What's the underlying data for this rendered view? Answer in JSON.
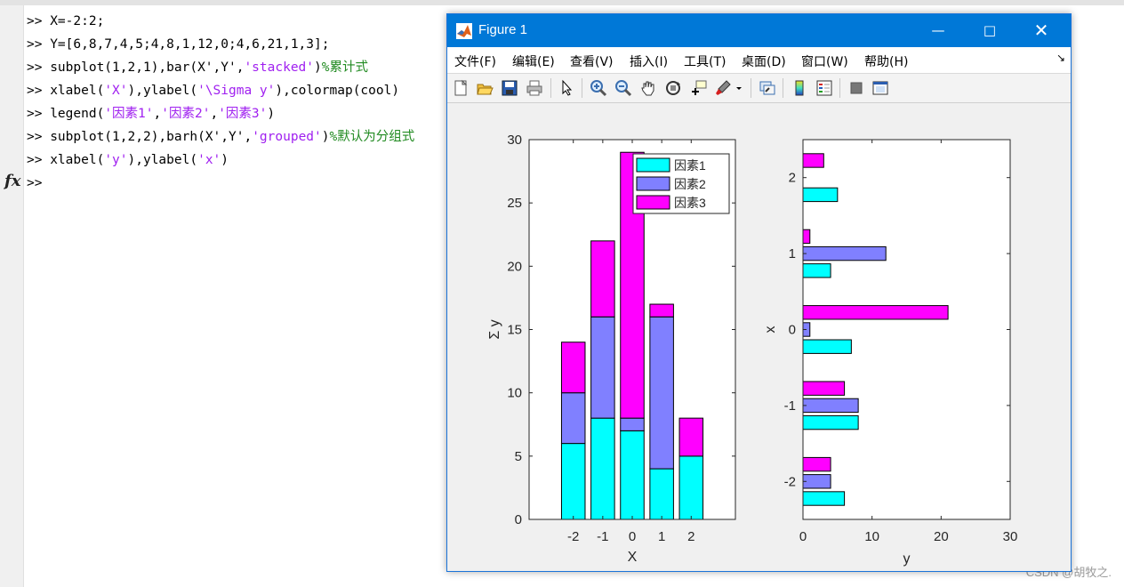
{
  "command_window": {
    "lines": [
      [
        {
          "t": ">> ",
          "c": "prompt"
        },
        {
          "t": "X=-2:2;",
          "c": "code"
        }
      ],
      [
        {
          "t": ">> ",
          "c": "prompt"
        },
        {
          "t": "Y=[6,8,7,4,5;4,8,1,12,0;4,6,21,1,3];",
          "c": "code"
        }
      ],
      [
        {
          "t": ">> ",
          "c": "prompt"
        },
        {
          "t": "subplot(1,2,1),bar(X',Y',",
          "c": "code"
        },
        {
          "t": "'stacked'",
          "c": "str"
        },
        {
          "t": ")",
          "c": "code"
        },
        {
          "t": "%累计式",
          "c": "cmt"
        }
      ],
      [
        {
          "t": ">> ",
          "c": "prompt"
        },
        {
          "t": "xlabel(",
          "c": "code"
        },
        {
          "t": "'X'",
          "c": "str"
        },
        {
          "t": "),ylabel(",
          "c": "code"
        },
        {
          "t": "'\\Sigma y'",
          "c": "str"
        },
        {
          "t": "),colormap(cool)",
          "c": "code"
        }
      ],
      [
        {
          "t": ">> ",
          "c": "prompt"
        },
        {
          "t": "legend(",
          "c": "code"
        },
        {
          "t": "'因素1'",
          "c": "str"
        },
        {
          "t": ",",
          "c": "code"
        },
        {
          "t": "'因素2'",
          "c": "str"
        },
        {
          "t": ",",
          "c": "code"
        },
        {
          "t": "'因素3'",
          "c": "str"
        },
        {
          "t": ")",
          "c": "code"
        }
      ],
      [
        {
          "t": ">> ",
          "c": "prompt"
        },
        {
          "t": "subplot(1,2,2),barh(X',Y',",
          "c": "code"
        },
        {
          "t": "'grouped'",
          "c": "str"
        },
        {
          "t": ")",
          "c": "code"
        },
        {
          "t": "%默认为分组式",
          "c": "cmt"
        }
      ],
      [
        {
          "t": ">> ",
          "c": "prompt"
        },
        {
          "t": "xlabel(",
          "c": "code"
        },
        {
          "t": "'y'",
          "c": "str"
        },
        {
          "t": "),ylabel(",
          "c": "code"
        },
        {
          "t": "'x'",
          "c": "str"
        },
        {
          "t": ")",
          "c": "code"
        }
      ],
      [
        {
          "t": ">> ",
          "c": "prompt"
        }
      ]
    ],
    "fx_label": "fx"
  },
  "figure": {
    "title": "Figure 1",
    "menu": [
      {
        "label": "文件(F)"
      },
      {
        "label": "编辑(E)"
      },
      {
        "label": "查看(V)"
      },
      {
        "label": "插入(I)"
      },
      {
        "label": "工具(T)"
      },
      {
        "label": "桌面(D)"
      },
      {
        "label": "窗口(W)"
      },
      {
        "label": "帮助(H)"
      }
    ],
    "toolbar_icons": [
      "new-figure-icon",
      "open-file-icon",
      "save-icon",
      "print-icon",
      "select-arrow-icon",
      "zoom-in-icon",
      "zoom-out-icon",
      "pan-hand-icon",
      "rotate-3d-icon",
      "data-cursor-icon",
      "brush-icon",
      "link-plot-icon",
      "colorbar-icon",
      "legend-icon",
      "hide-plot-tools-icon",
      "show-plot-tools-icon"
    ]
  },
  "colors": {
    "series1": "#00ffff",
    "series2": "#8080ff",
    "series3": "#ff00ff",
    "accent": "#0078d7"
  },
  "chart_data": [
    {
      "type": "bar",
      "mode": "stacked",
      "categories": [
        "-2",
        "-1",
        "0",
        "1",
        "2"
      ],
      "series": [
        {
          "name": "因素1",
          "values": [
            6,
            8,
            7,
            4,
            5
          ]
        },
        {
          "name": "因素2",
          "values": [
            4,
            8,
            1,
            12,
            0
          ]
        },
        {
          "name": "因素3",
          "values": [
            4,
            6,
            21,
            1,
            3
          ]
        }
      ],
      "xlabel": "X",
      "ylabel": "Σ y",
      "ylim": [
        0,
        30
      ],
      "yticks": [
        "0",
        "5",
        "10",
        "15",
        "20",
        "25",
        "30"
      ],
      "legend": "top-right"
    },
    {
      "type": "bar",
      "mode": "grouped-horizontal",
      "categories": [
        "-2",
        "-1",
        "0",
        "1",
        "2"
      ],
      "series": [
        {
          "values": [
            6,
            8,
            7,
            4,
            5
          ]
        },
        {
          "values": [
            4,
            8,
            1,
            12,
            0
          ]
        },
        {
          "values": [
            4,
            6,
            21,
            1,
            3
          ]
        }
      ],
      "xlabel": "y",
      "ylabel": "x",
      "xlim": [
        0,
        30
      ],
      "xticks": [
        "0",
        "10",
        "20",
        "30"
      ]
    }
  ],
  "watermark": "CSDN @胡牧之."
}
